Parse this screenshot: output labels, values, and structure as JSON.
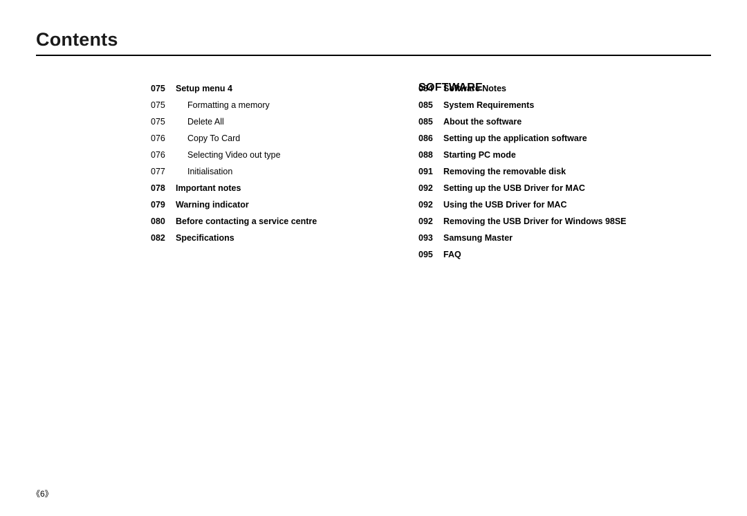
{
  "header": {
    "title": "Contents"
  },
  "left_column": [
    {
      "num": "075",
      "text": "Setup menu 4",
      "style": "bold"
    },
    {
      "num": "075",
      "text": "Formatting a memory",
      "style": "sub"
    },
    {
      "num": "075",
      "text": "Delete All",
      "style": "sub"
    },
    {
      "num": "076",
      "text": "Copy To Card",
      "style": "sub"
    },
    {
      "num": "076",
      "text": "Selecting Video out type",
      "style": "sub"
    },
    {
      "num": "077",
      "text": "Initialisation",
      "style": "sub"
    },
    {
      "num": "078",
      "text": "Important notes",
      "style": "bold"
    },
    {
      "num": "079",
      "text": "Warning indicator",
      "style": "bold"
    },
    {
      "num": "080",
      "text": "Before contacting a service centre",
      "style": "bold"
    },
    {
      "num": "082",
      "text": "Specifications",
      "style": "bold"
    }
  ],
  "section_label": "SOFTWARE",
  "right_column": [
    {
      "num": "084",
      "text": "Software Notes"
    },
    {
      "num": "085",
      "text": "System Requirements"
    },
    {
      "num": "085",
      "text": "About the software"
    },
    {
      "num": "086",
      "text": "Setting up the application software"
    },
    {
      "num": "088",
      "text": "Starting PC mode"
    },
    {
      "num": "091",
      "text": "Removing the removable disk"
    },
    {
      "num": "092",
      "text": "Setting up the USB Driver for MAC"
    },
    {
      "num": "092",
      "text": "Using the USB Driver for MAC"
    },
    {
      "num": "092",
      "text": "Removing the USB Driver for Windows 98SE"
    },
    {
      "num": "093",
      "text": "Samsung Master"
    },
    {
      "num": "095",
      "text": "FAQ"
    }
  ],
  "footer": {
    "page_number": "《6》"
  }
}
